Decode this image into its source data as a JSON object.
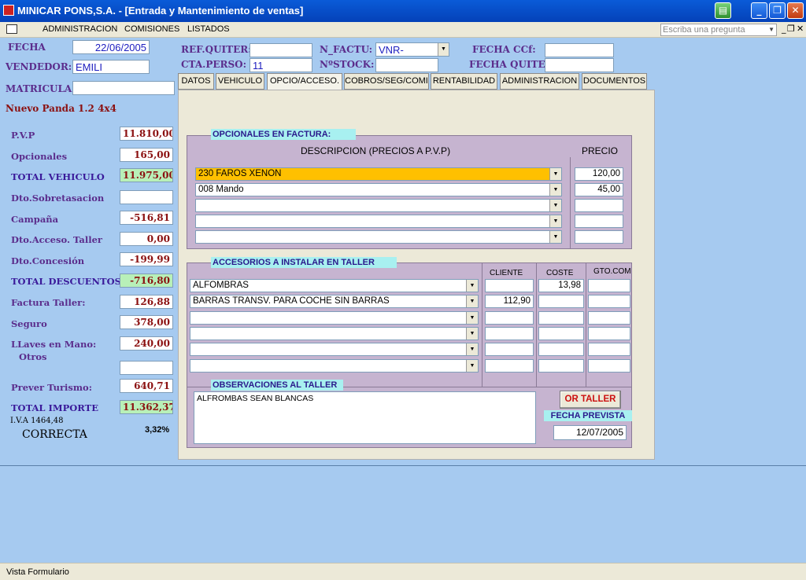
{
  "window": {
    "title": "MINICAR PONS,S.A. - [Entrada y Mantenimiento de ventas]",
    "buttons": {
      "minimize": "_",
      "restore": "❐",
      "close": "✕"
    }
  },
  "menubar": {
    "items": [
      "ADMINISTRACION",
      "COMISIONES",
      "LISTADOS"
    ],
    "ask_placeholder": "Escriba una pregunta",
    "mdi": {
      "minimize": "_",
      "restore": "❐",
      "close": "✕"
    }
  },
  "header": {
    "fecha_label": "FECHA",
    "fecha_value": "22/06/2005",
    "vendedor_label": "VENDEDOR:",
    "vendedor_value": "EMILI",
    "matricula_label": "MATRICULA:",
    "matricula_value": "",
    "ref_quiter_label": "REF.QUITER:",
    "ref_quiter_value": "",
    "cta_perso_label": "CTA.PERSO:",
    "cta_perso_value": "11",
    "n_factu_label": "N_FACTU:",
    "n_factu_value": "VNR-",
    "nstock_label": "NºSTOCK:",
    "nstock_value": "",
    "fecha_ccf_label": "FECHA CCf:",
    "fecha_ccf_value": "",
    "fecha_quiter_label": "FECHA QUITER",
    "fecha_quiter_value": ""
  },
  "model": "Nuevo Panda 1.2 4x4",
  "summary": [
    {
      "label": "P.V.P",
      "value": "11.810,00",
      "total": false
    },
    {
      "label": "Opcionales",
      "value": "165,00",
      "total": false
    },
    {
      "label": "TOTAL VEHICULO",
      "value": "11.975,00",
      "total": true
    },
    {
      "label": "Dto.Sobretasacion",
      "value": "",
      "total": false
    },
    {
      "label": "Campaña",
      "value": "-516,81",
      "total": false
    },
    {
      "label": "Dto.Acceso. Taller",
      "value": "0,00",
      "total": false
    },
    {
      "label": "Dto.Concesión",
      "value": "-199,99",
      "total": false
    },
    {
      "label": "TOTAL DESCUENTOS",
      "value": "-716,80",
      "total": true
    },
    {
      "label": "Factura Taller:",
      "value": "126,88",
      "total": false
    },
    {
      "label": "Seguro",
      "value": "378,00",
      "total": false
    },
    {
      "label": "LLaves en Mano:",
      "value": "240,00",
      "total": false
    },
    {
      "label": "Otros",
      "value": "",
      "total": false
    },
    {
      "label": "Prever Turismo:",
      "value": "640,71",
      "total": false
    },
    {
      "label": "TOTAL IMPORTE",
      "value": "11.362,37",
      "total": true
    }
  ],
  "iva_text": "I.V.A  1464,48",
  "status_word": "CORRECTA",
  "percent": "3,32%",
  "tabs": [
    "DATOS",
    "VEHICULO",
    "OPCIO/ACCESO.",
    "COBROS/SEG/COMI",
    "RENTABILIDAD",
    "ADMINISTRACION",
    "DOCUMENTOS"
  ],
  "active_tab": "OPCIO/ACCESO.",
  "opcionales": {
    "title": "OPCIONALES EN FACTURA:",
    "col_desc": "DESCRIPCION (PRECIOS A P.V.P)",
    "col_price": "PRECIO",
    "rows": [
      {
        "desc": "230 FAROS XENON",
        "price": "120,00"
      },
      {
        "desc": "008 Mando",
        "price": "45,00"
      },
      {
        "desc": "",
        "price": ""
      },
      {
        "desc": "",
        "price": ""
      },
      {
        "desc": "",
        "price": ""
      }
    ]
  },
  "accesorios": {
    "title": "ACCESORIOS A INSTALAR EN TALLER",
    "col_cliente": "CLIENTE",
    "col_coste": "COSTE",
    "col_gto": "GTO.COM",
    "rows": [
      {
        "desc": "ALFOMBRAS",
        "cliente": "",
        "coste": "13,98",
        "gto": ""
      },
      {
        "desc": "BARRAS TRANSV. PARA COCHE SIN BARRAS",
        "cliente": "112,90",
        "coste": "",
        "gto": ""
      },
      {
        "desc": "",
        "cliente": "",
        "coste": "",
        "gto": ""
      },
      {
        "desc": "",
        "cliente": "",
        "coste": "",
        "gto": ""
      },
      {
        "desc": "",
        "cliente": "",
        "coste": "",
        "gto": ""
      },
      {
        "desc": "",
        "cliente": "",
        "coste": "",
        "gto": ""
      }
    ]
  },
  "observaciones": {
    "title": "OBSERVACIONES AL TALLER",
    "text": "ALFROMBAS SEAN BLANCAS"
  },
  "or_taller_button": "OR TALLER",
  "fecha_prevista_label": "FECHA PREVISTA",
  "fecha_prevista_value": "12/07/2005",
  "statusbar": "Vista Formulario",
  "colors": {
    "titlebar": "#0a5bd8",
    "form_bg": "#a6caf0",
    "section_bg": "#c6b4d0",
    "highlight": "#ffc000",
    "total_bg": "#b8f0b8"
  }
}
